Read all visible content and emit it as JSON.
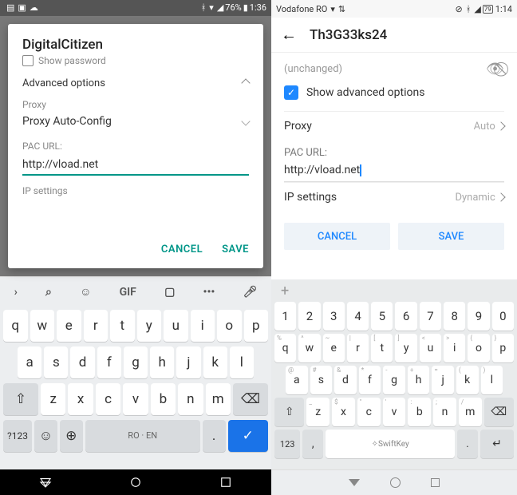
{
  "left": {
    "status": {
      "battery": "76%",
      "time": "1:36"
    },
    "dialog": {
      "title": "DigitalCitizen",
      "show_password": "Show password",
      "advanced_options": "Advanced options",
      "proxy_label": "Proxy",
      "proxy_value": "Proxy Auto-Config",
      "pac_label": "PAC URL:",
      "pac_value": "http://vload.net",
      "ip_settings": "IP settings",
      "cancel": "CANCEL",
      "save": "SAVE"
    },
    "keyboard": {
      "gif": "GIF",
      "rows": [
        [
          "q",
          "w",
          "e",
          "r",
          "t",
          "y",
          "u",
          "i",
          "o",
          "p"
        ],
        [
          "a",
          "s",
          "d",
          "f",
          "g",
          "h",
          "j",
          "k",
          "l"
        ],
        [
          "z",
          "x",
          "c",
          "v",
          "b",
          "n",
          "m"
        ]
      ],
      "sym": "?123",
      "space": "RO · EN"
    }
  },
  "right": {
    "status": {
      "carrier": "Vodafone RO",
      "time": "1:14",
      "battery": "79"
    },
    "header": {
      "title": "Th3G33ks24"
    },
    "content": {
      "unchanged": "(unchanged)",
      "show_advanced": "Show advanced options",
      "proxy_label": "Proxy",
      "proxy_value": "Auto",
      "pac_label": "PAC URL:",
      "pac_value": "http://vload.net",
      "ip_label": "IP settings",
      "ip_value": "Dynamic",
      "cancel": "CANCEL",
      "save": "SAVE"
    },
    "keyboard": {
      "nums": [
        "1",
        "2",
        "3",
        "4",
        "5",
        "6",
        "7",
        "8",
        "9",
        "0"
      ],
      "r1": [
        {
          "k": "q",
          "s": "%"
        },
        {
          "k": "w",
          "s": "^"
        },
        {
          "k": "e",
          "s": "~"
        },
        {
          "k": "r",
          "s": "|"
        },
        {
          "k": "t",
          "s": "["
        },
        {
          "k": "y",
          "s": "]"
        },
        {
          "k": "u",
          "s": "<"
        },
        {
          "k": "i",
          "s": ">"
        },
        {
          "k": "o",
          "s": "{"
        },
        {
          "k": "p",
          "s": "}"
        }
      ],
      "r2": [
        {
          "k": "a",
          "s": "@"
        },
        {
          "k": "s",
          "s": "#"
        },
        {
          "k": "d",
          "s": "&"
        },
        {
          "k": "f",
          "s": "*"
        },
        {
          "k": "g",
          "s": "-"
        },
        {
          "k": "h",
          "s": "+"
        },
        {
          "k": "j",
          "s": "="
        },
        {
          "k": "k",
          "s": "("
        },
        {
          "k": "l",
          "s": ")"
        }
      ],
      "r3": [
        {
          "k": "z",
          "s": "_"
        },
        {
          "k": "x",
          "s": "$"
        },
        {
          "k": "c",
          "s": "\""
        },
        {
          "k": "v",
          "s": "'"
        },
        {
          "k": "b",
          "s": ":"
        },
        {
          "k": "n",
          "s": ";"
        },
        {
          "k": "m",
          "s": "/"
        }
      ],
      "sym": "123",
      "space": "SwiftKey"
    }
  }
}
